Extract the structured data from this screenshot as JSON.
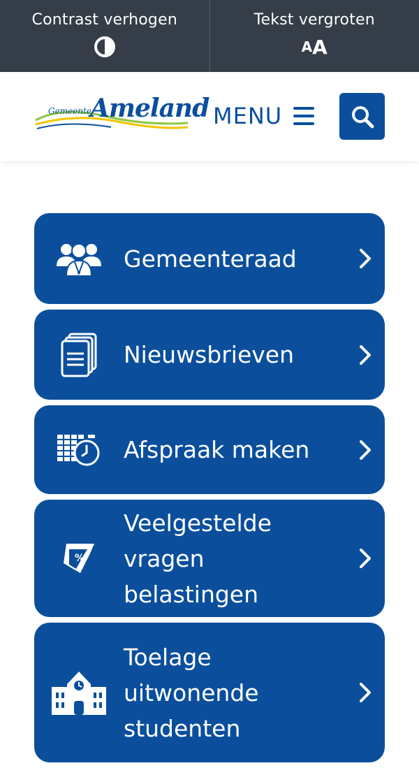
{
  "accessibility": {
    "contrast_label": "Contrast verhogen",
    "text_label": "Tekst vergroten",
    "text_icon_small": "A",
    "text_icon_big": "A"
  },
  "header": {
    "logo_small": "Gemeente",
    "logo_big": "Ameland",
    "menu_label": "MENU"
  },
  "tiles": [
    {
      "label": "Gemeenteraad",
      "icon": "council-members-icon"
    },
    {
      "label": "Nieuwsbrieven",
      "icon": "documents-icon"
    },
    {
      "label": "Afspraak maken",
      "icon": "calendar-clock-icon"
    },
    {
      "label": "Veelgestelde vragen belastingen",
      "icon": "tax-tag-icon"
    },
    {
      "label": "Toelage uitwonende studenten",
      "icon": "school-building-icon"
    }
  ],
  "colors": {
    "primary": "#0b4f9c",
    "topbar": "#343d48",
    "logo_green": "#8cc63f",
    "logo_yellow": "#f2c500"
  }
}
